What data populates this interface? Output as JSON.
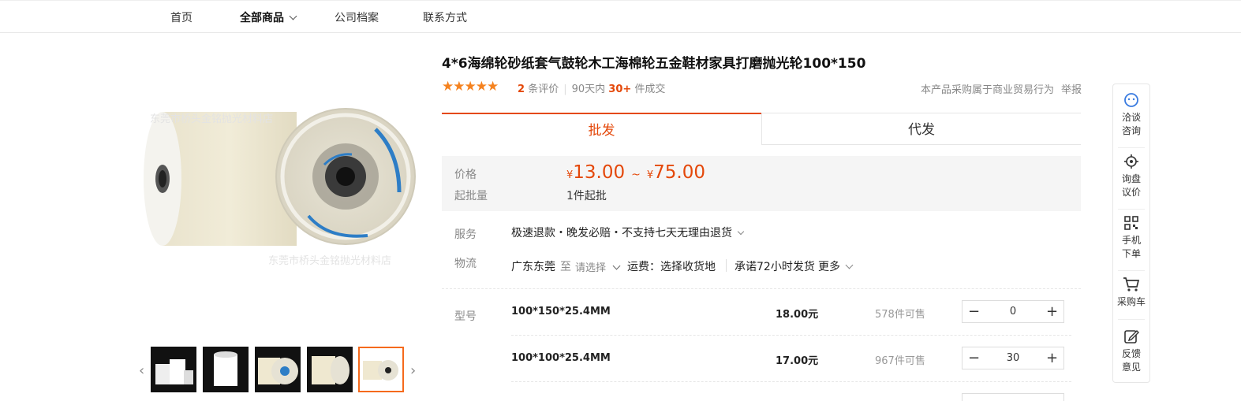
{
  "nav": {
    "items": [
      "首页",
      "全部商品",
      "公司档案",
      "联系方式"
    ]
  },
  "gallery": {
    "watermark_top": "东莞市桥头金铭抛光材料店",
    "watermark_bottom": "东莞市桥头金铭抛光材料店",
    "thumb_count": 5,
    "selected_thumb": 5
  },
  "product": {
    "title": "4*6海绵轮砂纸套气鼓轮木工海棉轮五金鞋材家具打磨抛光轮100*150",
    "stars": "★★★★★",
    "reviews_count": "2",
    "reviews_label": "条评价",
    "sales_period": "90天内",
    "sales_count": "30+",
    "sales_label": "件成交",
    "trade_note": "本产品采购属于商业贸易行为",
    "report": "举报"
  },
  "tabs": {
    "wholesale": "批发",
    "dropship": "代发"
  },
  "price": {
    "label": "价格",
    "currency": "¥",
    "min": "13.00",
    "tilde": "~",
    "max": "75.00",
    "moq_label": "起批量",
    "moq_value": "1件起批"
  },
  "service": {
    "label": "服务",
    "value": "极速退款・晚发必赔・不支持七天无理由退货"
  },
  "logistics": {
    "label": "物流",
    "from": "广东东莞",
    "to": "至",
    "select": "请选择",
    "fee": "运费：选择收货地",
    "promise": "承诺72小时发货",
    "more": "更多"
  },
  "sku": {
    "label": "型号",
    "rows": [
      {
        "name": "100*150*25.4MM",
        "price": "18.00元",
        "stock": "578件可售",
        "qty": "0"
      },
      {
        "name": "100*100*25.4MM",
        "price": "17.00元",
        "stock": "967件可售",
        "qty": "30"
      }
    ],
    "minus": "−",
    "plus": "+"
  },
  "sidebar": {
    "chat_1": "洽谈",
    "chat_2": "咨询",
    "inquiry_1": "询盘",
    "inquiry_2": "议价",
    "mobile_1": "手机",
    "mobile_2": "下单",
    "cart": "采购车",
    "feedback_1": "反馈",
    "feedback_2": "意见"
  },
  "colors": {
    "accent": "#e4480a",
    "star": "#f5821f",
    "sidebar_icon": "#3a7be0"
  }
}
